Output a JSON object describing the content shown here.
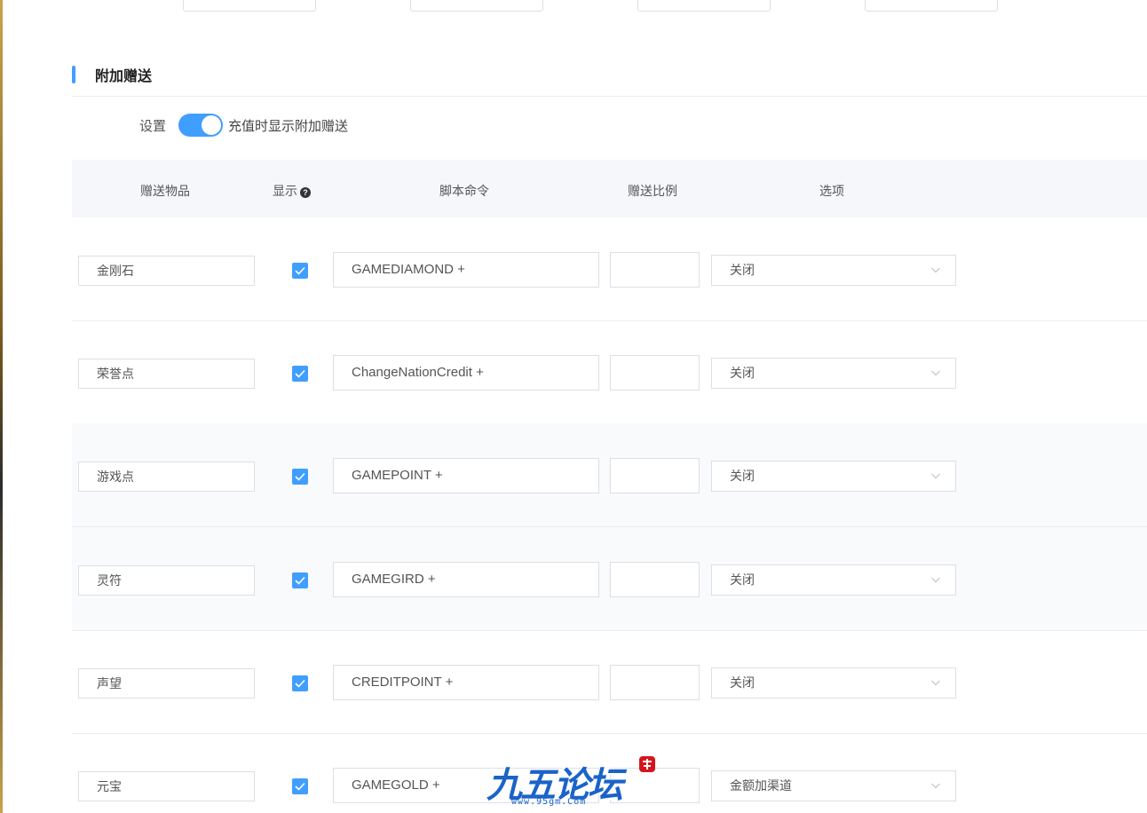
{
  "section": {
    "title": "附加赠送"
  },
  "setting": {
    "label": "设置",
    "toggle_on": true,
    "description": "充值时显示附加赠送"
  },
  "table": {
    "headers": {
      "item": "赠送物品",
      "display": "显示",
      "script": "脚本命令",
      "ratio": "赠送比例",
      "option": "选项"
    },
    "rows": [
      {
        "item": "金刚石",
        "display": true,
        "script": "GAMEDIAMOND +",
        "ratio": "",
        "option": "关闭"
      },
      {
        "item": "荣誉点",
        "display": true,
        "script": "ChangeNationCredit +",
        "ratio": "",
        "option": "关闭"
      },
      {
        "item": "游戏点",
        "display": true,
        "script": "GAMEPOINT +",
        "ratio": "",
        "option": "关闭"
      },
      {
        "item": "灵符",
        "display": true,
        "script": "GAMEGIRD +",
        "ratio": "",
        "option": "关闭"
      },
      {
        "item": "声望",
        "display": true,
        "script": "CREDITPOINT +",
        "ratio": "",
        "option": "关闭"
      },
      {
        "item": "元宝",
        "display": true,
        "script": "GAMEGOLD +",
        "ratio": "",
        "option": "金额加渠道"
      }
    ]
  },
  "colors": {
    "accent": "#409eff",
    "header_bg": "#f5f7fa",
    "border": "#dcdfe6"
  },
  "icons": {
    "help": "question-circle-icon",
    "check": "check-icon",
    "chevron": "chevron-down-icon"
  },
  "watermark": {
    "logo": "九五论坛",
    "url": "www.95gm.Com"
  }
}
